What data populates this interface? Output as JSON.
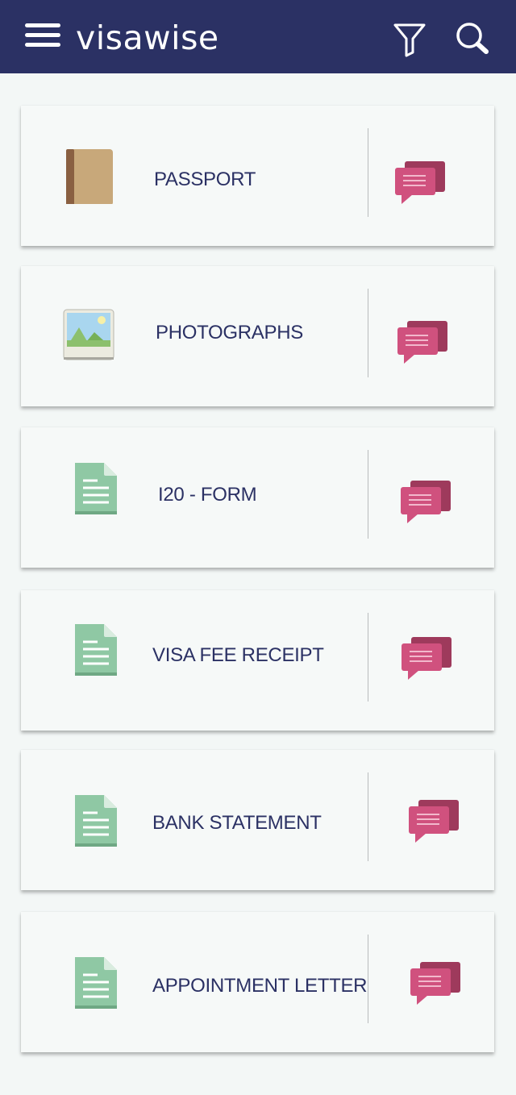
{
  "app": {
    "title": "visawise"
  },
  "header_icons": {
    "menu": "menu-icon",
    "filter": "filter-icon",
    "search": "search-icon"
  },
  "colors": {
    "app_bar": "#2b3164",
    "card_background": "#f6f9f8",
    "title_text": "#2b3164",
    "chat_front": "#d0517e",
    "chat_back": "#9e3a5c",
    "document_green": "#8fc8a4",
    "passport_brown": "#c8a87a"
  },
  "documents": [
    {
      "title": "PASSPORT",
      "icon": "passport-icon",
      "action_icon": "chat-bubbles-icon"
    },
    {
      "title": "PHOTOGRAPHS",
      "icon": "photo-icon",
      "action_icon": "chat-bubbles-icon"
    },
    {
      "title": "I20 - FORM",
      "icon": "document-icon",
      "action_icon": "chat-bubbles-icon"
    },
    {
      "title": "VISA FEE RECEIPT",
      "icon": "document-icon",
      "action_icon": "chat-bubbles-icon"
    },
    {
      "title": "BANK STATEMENT",
      "icon": "document-icon",
      "action_icon": "chat-bubbles-icon"
    },
    {
      "title": "APPOINTMENT LETTER",
      "icon": "document-icon",
      "action_icon": "chat-bubbles-icon"
    }
  ]
}
